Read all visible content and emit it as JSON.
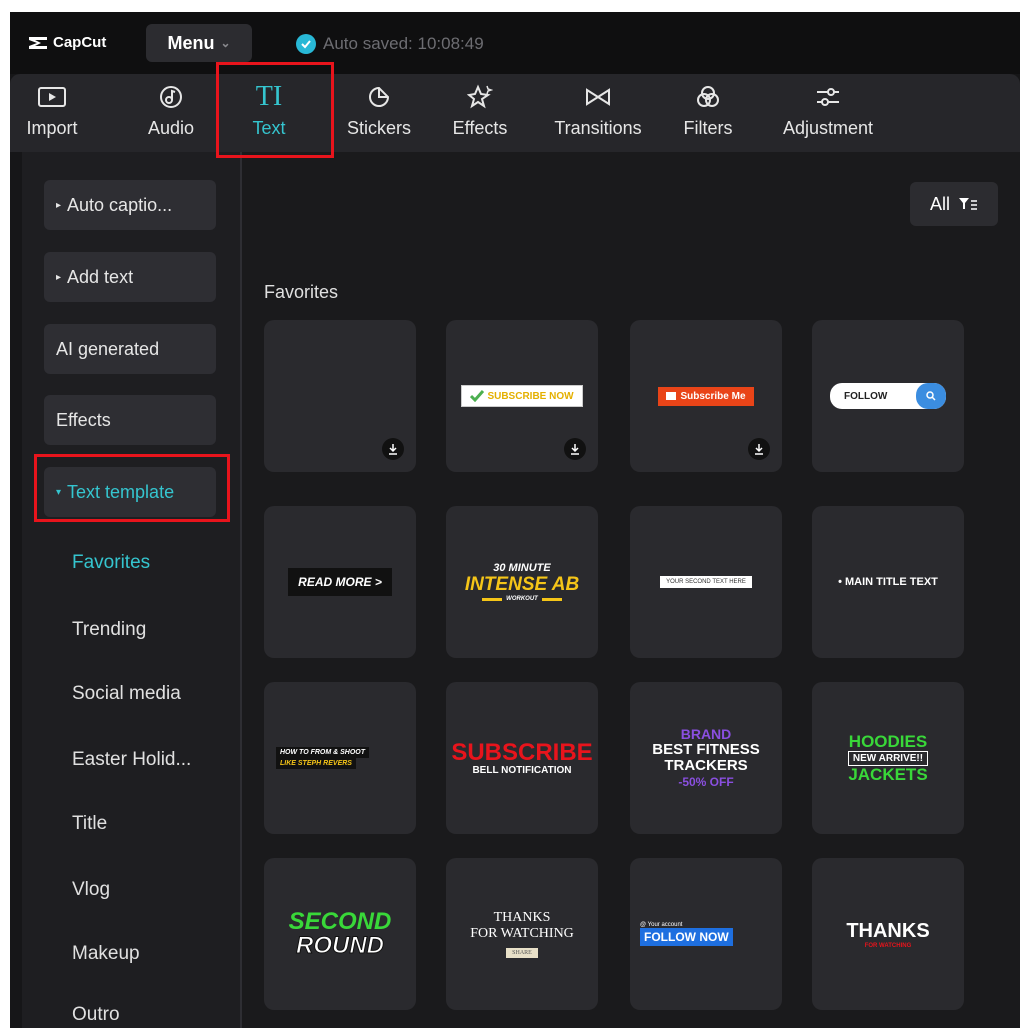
{
  "app": {
    "logo_text": "CapCut",
    "menu_label": "Menu",
    "menu_chevron": "⌄",
    "saved_text": "Auto saved: 10:08:49"
  },
  "toolbar": {
    "import": "Import",
    "audio": "Audio",
    "text": "Text",
    "text_icon": "TI",
    "stickers": "Stickers",
    "effects": "Effects",
    "transitions": "Transitions",
    "filters": "Filters",
    "adjustment": "Adjustment"
  },
  "sidebar": {
    "auto_captions": "Auto captio...",
    "add_text": "Add text",
    "ai_generated": "AI generated",
    "effects": "Effects",
    "text_template": "Text template",
    "categories": [
      "Favorites",
      "Trending",
      "Social media",
      "Easter Holid...",
      "Title",
      "Vlog",
      "Makeup",
      "Outro"
    ]
  },
  "main": {
    "filter_label": "All",
    "section_title": "Favorites",
    "cards": {
      "c2": "SUBSCRIBE NOW",
      "c3": "Subscribe Me",
      "c4": "FOLLOW",
      "c5": "READ MORE >",
      "c6a": "30 MINUTE",
      "c6b": "INTENSE AB",
      "c6c": "WORKOUT",
      "c7": "YOUR SECOND TEXT HERE",
      "c8": "• MAIN TITLE TEXT",
      "c9a": "HOW TO FROM & SHOOT",
      "c9b": "LIKE STEPH REVERS",
      "c10a": "SUBSCRIBE",
      "c10b": "BELL NOTIFICATION",
      "c11a": "BRAND",
      "c11b": "BEST FITNESS",
      "c11c": "TRACKERS",
      "c11d": "-50% OFF",
      "c12a": "HOODIES",
      "c12b": "NEW ARRIVE!!",
      "c12c": "JACKETS",
      "c13a": "SECOND",
      "c13b": "ROUND",
      "c14a": "THANKS",
      "c14b": "FOR WATCHING",
      "c14c": "SHARE",
      "c15a": "@ Your account",
      "c15b": "FOLLOW NOW",
      "c16a": "THANKS",
      "c16b": "FOR WATCHING"
    }
  },
  "colors": {
    "accent": "#35c5cf",
    "highlight": "#e8141c",
    "background": "#161618"
  }
}
